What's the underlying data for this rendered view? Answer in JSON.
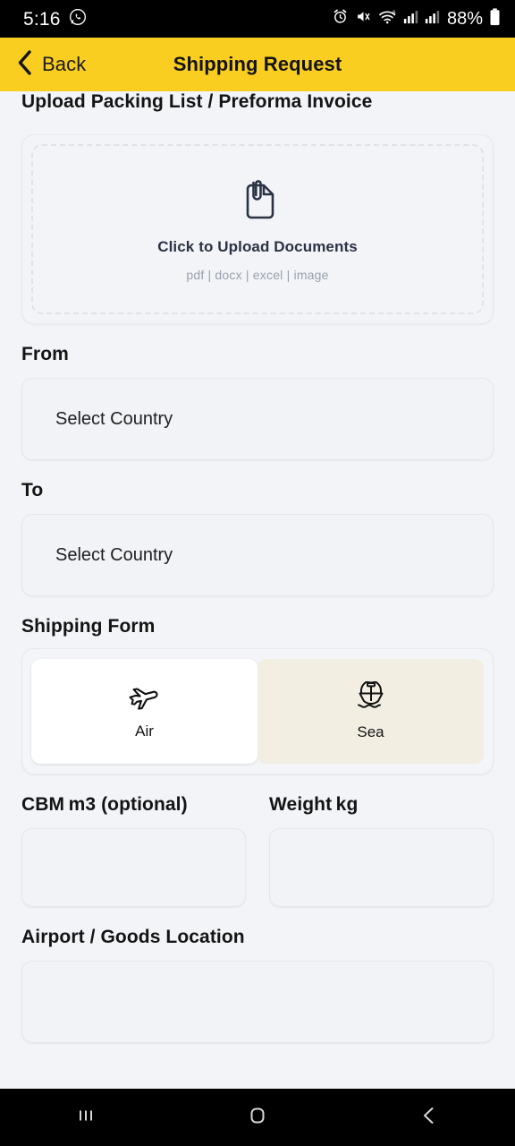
{
  "status_bar": {
    "time": "5:16",
    "whatsapp_icon": "whatsapp-icon",
    "alarm_icon": "alarm-clock-icon",
    "mute_icon": "volume-muted-icon",
    "wifi_icon": "wifi-6-icon",
    "signal_icon_1": "cellular-signal-icon",
    "signal_icon_2": "cellular-signal-icon",
    "battery_percent": "88%",
    "battery_icon": "battery-icon"
  },
  "header": {
    "back_label": "Back",
    "back_icon": "chevron-left-icon",
    "title": "Shipping Request",
    "background_color": "#F9CE21"
  },
  "upload": {
    "label": "Upload Packing List / Preforma Invoice",
    "icon": "document-attachment-icon",
    "cta": "Click to Upload Documents",
    "accepted_types": "pdf | docx | excel | image"
  },
  "from": {
    "label": "From",
    "placeholder": "Select Country",
    "value": ""
  },
  "to": {
    "label": "To",
    "placeholder": "Select Country",
    "value": ""
  },
  "shipping_form": {
    "label": "Shipping Form",
    "options": [
      {
        "label": "Air",
        "icon": "airplane-icon",
        "selected": true
      },
      {
        "label": "Sea",
        "icon": "ship-icon",
        "selected": false
      }
    ],
    "selected_background": "#FFFFFF",
    "unselected_background": "#F2EFE2"
  },
  "cbm": {
    "label": "CBM",
    "unit": "m3 (optional)",
    "value": ""
  },
  "weight": {
    "label": "Weight",
    "unit": "kg",
    "value": ""
  },
  "airport_location": {
    "label": "Airport / Goods Location",
    "value": ""
  },
  "nav_bar": {
    "recents_icon": "recents-icon",
    "home_icon": "home-icon",
    "back_icon": "back-chevron-icon"
  }
}
